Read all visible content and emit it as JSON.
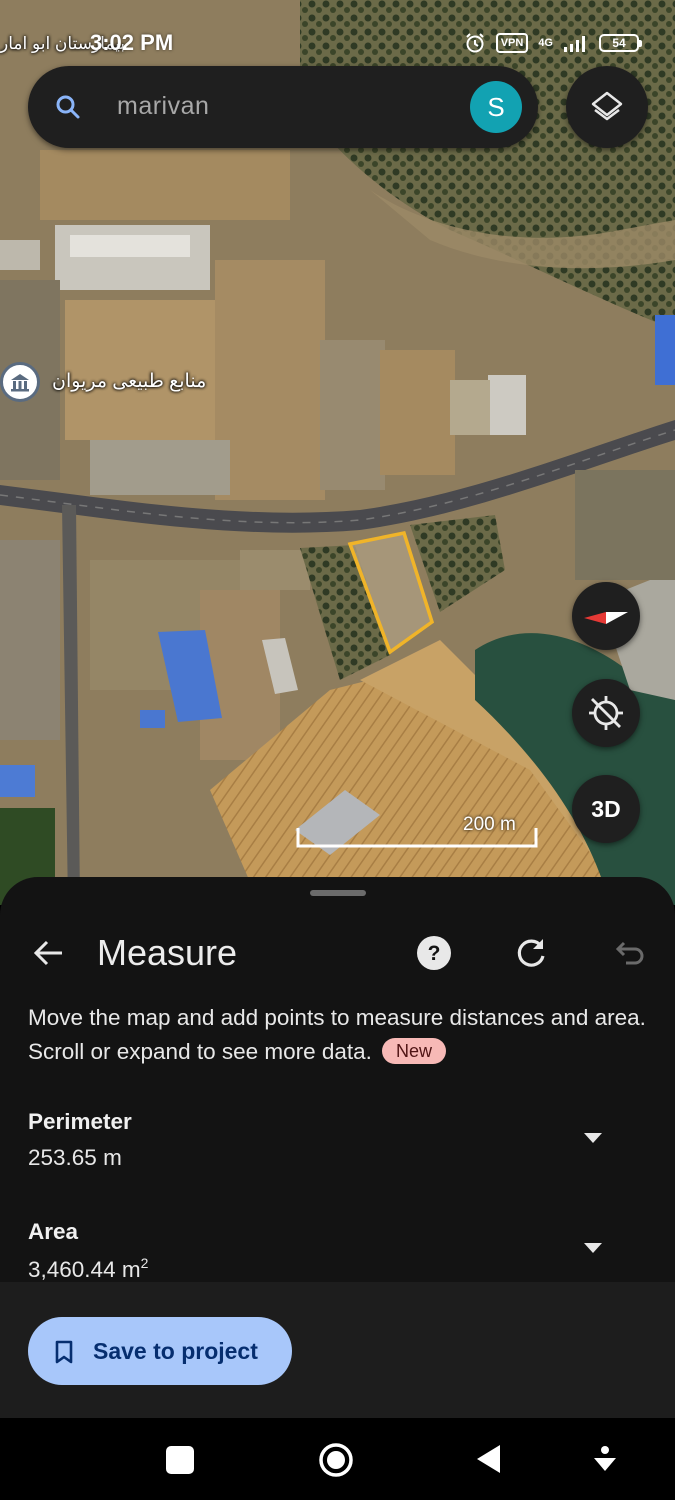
{
  "status": {
    "time": "3:02 PM",
    "vpn": "VPN",
    "network": "4G",
    "battery": "54"
  },
  "map": {
    "search_text": "marivan",
    "avatar_letter": "S",
    "label_natural_resources": "منابع طبیعی مریوان",
    "label_top": "بیمارستان ابو امار",
    "scale": "200 m",
    "button_3d": "3D",
    "colors": {
      "measure_outline": "#f0b429",
      "avatar": "#12a2b2"
    }
  },
  "sheet": {
    "title": "Measure",
    "instruction": "Move the map and add points to measure distances and area. Scroll or expand to see more data.",
    "badge": "New",
    "perimeter": {
      "label": "Perimeter",
      "value": "253.65 m"
    },
    "area": {
      "label": "Area",
      "value": "3,460.44 m",
      "unit_sup": "2"
    },
    "save_label": "Save to project"
  },
  "icons": [
    "search-icon",
    "layers-icon",
    "compass-icon",
    "location-disabled-icon",
    "back-arrow-icon",
    "help-icon",
    "redo-icon",
    "undo-icon",
    "chevron-down-icon",
    "bookmark-icon",
    "alarm-icon",
    "signal-icon"
  ]
}
